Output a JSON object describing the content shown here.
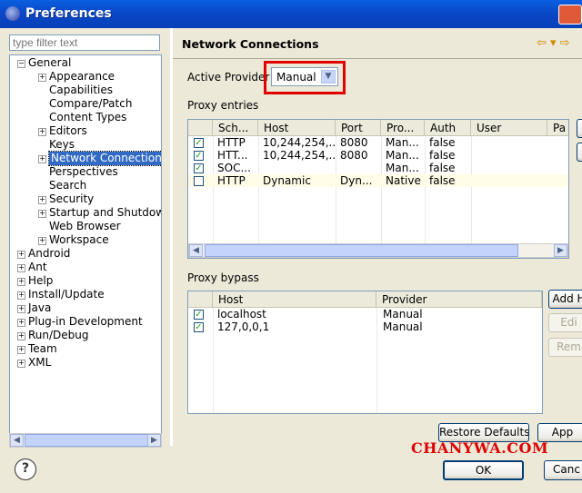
{
  "window": {
    "title": "Preferences"
  },
  "sidebar": {
    "filter_placeholder": "type filter text",
    "tree": [
      {
        "label": "General",
        "exp": "−",
        "level": 0
      },
      {
        "label": "Appearance",
        "exp": "+",
        "level": 1
      },
      {
        "label": "Capabilities",
        "exp": "",
        "level": 1
      },
      {
        "label": "Compare/Patch",
        "exp": "",
        "level": 1
      },
      {
        "label": "Content Types",
        "exp": "",
        "level": 1
      },
      {
        "label": "Editors",
        "exp": "+",
        "level": 1
      },
      {
        "label": "Keys",
        "exp": "",
        "level": 1
      },
      {
        "label": "Network Connections",
        "exp": "+",
        "level": 1,
        "selected": true
      },
      {
        "label": "Perspectives",
        "exp": "",
        "level": 1
      },
      {
        "label": "Search",
        "exp": "",
        "level": 1
      },
      {
        "label": "Security",
        "exp": "+",
        "level": 1
      },
      {
        "label": "Startup and Shutdown",
        "exp": "+",
        "level": 1
      },
      {
        "label": "Web Browser",
        "exp": "",
        "level": 1
      },
      {
        "label": "Workspace",
        "exp": "+",
        "level": 1
      },
      {
        "label": "Android",
        "exp": "+",
        "level": 0
      },
      {
        "label": "Ant",
        "exp": "+",
        "level": 0
      },
      {
        "label": "Help",
        "exp": "+",
        "level": 0
      },
      {
        "label": "Install/Update",
        "exp": "+",
        "level": 0
      },
      {
        "label": "Java",
        "exp": "+",
        "level": 0
      },
      {
        "label": "Plug-in Development",
        "exp": "+",
        "level": 0
      },
      {
        "label": "Run/Debug",
        "exp": "+",
        "level": 0
      },
      {
        "label": "Team",
        "exp": "+",
        "level": 0
      },
      {
        "label": "XML",
        "exp": "+",
        "level": 0
      }
    ]
  },
  "main": {
    "heading": "Network Connections",
    "active_provider_label": "Active Provider",
    "active_provider_value": "Manual",
    "proxy_entries_label": "Proxy entries",
    "proxy_columns": [
      "Sch...",
      "Host",
      "Port",
      "Pro...",
      "Auth",
      "User",
      "Pa"
    ],
    "proxy_rows": [
      {
        "checked": true,
        "cells": [
          "HTTP",
          "10,244,254,...",
          "8080",
          "Man...",
          "false",
          ""
        ]
      },
      {
        "checked": true,
        "cells": [
          "HTT...",
          "10,244,254,...",
          "8080",
          "Man...",
          "false",
          ""
        ]
      },
      {
        "checked": true,
        "cells": [
          "SOC...",
          "",
          "",
          "Man...",
          "false",
          ""
        ]
      },
      {
        "checked": false,
        "cells": [
          "HTTP",
          "Dynamic",
          "Dyn...",
          "Native",
          "false",
          ""
        ]
      }
    ],
    "proxy_bypass_label": "Proxy bypass",
    "bypass_columns": [
      "Host",
      "Provider"
    ],
    "bypass_rows": [
      {
        "checked": true,
        "host": "localhost",
        "provider": "Manual"
      },
      {
        "checked": true,
        "host": "127,0,0,1",
        "provider": "Manual"
      }
    ],
    "bypass_buttons": {
      "add": "Add H",
      "edit": "Edi",
      "remove": "Rem"
    },
    "restore_defaults": "Restore Defaults",
    "apply": "App"
  },
  "footer": {
    "ok": "OK",
    "cancel": "Canc"
  },
  "watermark": "CHANYWA.COM",
  "colors": {
    "selection": "#316ac5",
    "highlight_box": "#e00000",
    "title_bar": "#0a5fe0"
  }
}
